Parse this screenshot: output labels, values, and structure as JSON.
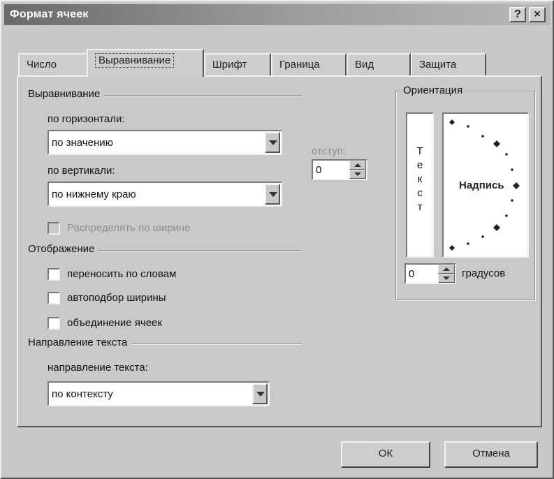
{
  "window": {
    "title": "Формат ячеек",
    "help_glyph": "?",
    "close_glyph": "×"
  },
  "tabs": [
    {
      "label": "Число"
    },
    {
      "label": "Выравнивание",
      "active": true
    },
    {
      "label": "Шрифт"
    },
    {
      "label": "Граница"
    },
    {
      "label": "Вид"
    },
    {
      "label": "Защита"
    }
  ],
  "alignment": {
    "section": "Выравнивание",
    "horizontal_label": "по горизонтали:",
    "horizontal_value": "по значению",
    "indent_label": "отступ:",
    "indent_value": "0",
    "vertical_label": "по вертикали:",
    "vertical_value": "по нижнему краю",
    "distribute_label": "Распределять по ширине"
  },
  "display": {
    "section": "Отображение",
    "wrap_label": "переносить по словам",
    "shrink_label": "автоподбор ширины",
    "merge_label": "объединение ячеек"
  },
  "direction": {
    "section": "Направление текста",
    "label": "направление текста:",
    "value": "по контексту"
  },
  "orientation": {
    "section": "Ориентация",
    "vertical_text": "Т е к с т",
    "dial_label": "Надпись",
    "degrees_value": "0",
    "degrees_label": "градусов"
  },
  "buttons": {
    "ok": "ОК",
    "cancel": "Отмена"
  }
}
